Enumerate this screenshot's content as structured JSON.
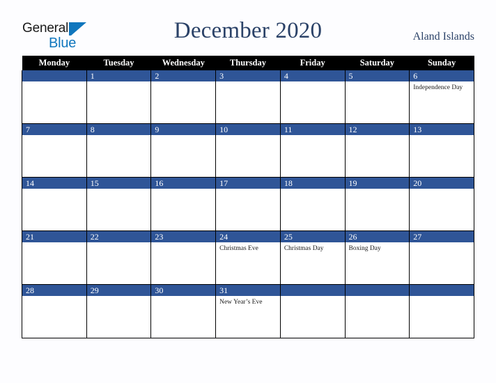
{
  "brand": {
    "name_part1": "General",
    "name_part2": "Blue",
    "logo_icon": "triangle-flag-icon"
  },
  "header": {
    "title": "December 2020",
    "country": "Aland Islands"
  },
  "calendar": {
    "month": "December",
    "year": "2020",
    "weekday_headers": [
      "Monday",
      "Tuesday",
      "Wednesday",
      "Thursday",
      "Friday",
      "Saturday",
      "Sunday"
    ],
    "colors": {
      "header_bg": "#000000",
      "date_bar_bg": "#2f5597",
      "title_text": "#2b4268",
      "brand_blue": "#0f76bd",
      "page_bg": "#fdfdff",
      "cell_bg": "#ffffff",
      "grid_line": "#000000"
    },
    "weeks": [
      [
        {
          "day": "",
          "event": ""
        },
        {
          "day": "1",
          "event": ""
        },
        {
          "day": "2",
          "event": ""
        },
        {
          "day": "3",
          "event": ""
        },
        {
          "day": "4",
          "event": ""
        },
        {
          "day": "5",
          "event": ""
        },
        {
          "day": "6",
          "event": "Independence Day"
        }
      ],
      [
        {
          "day": "7",
          "event": ""
        },
        {
          "day": "8",
          "event": ""
        },
        {
          "day": "9",
          "event": ""
        },
        {
          "day": "10",
          "event": ""
        },
        {
          "day": "11",
          "event": ""
        },
        {
          "day": "12",
          "event": ""
        },
        {
          "day": "13",
          "event": ""
        }
      ],
      [
        {
          "day": "14",
          "event": ""
        },
        {
          "day": "15",
          "event": ""
        },
        {
          "day": "16",
          "event": ""
        },
        {
          "day": "17",
          "event": ""
        },
        {
          "day": "18",
          "event": ""
        },
        {
          "day": "19",
          "event": ""
        },
        {
          "day": "20",
          "event": ""
        }
      ],
      [
        {
          "day": "21",
          "event": ""
        },
        {
          "day": "22",
          "event": ""
        },
        {
          "day": "23",
          "event": ""
        },
        {
          "day": "24",
          "event": "Christmas Eve"
        },
        {
          "day": "25",
          "event": "Christmas Day"
        },
        {
          "day": "26",
          "event": "Boxing Day"
        },
        {
          "day": "27",
          "event": ""
        }
      ],
      [
        {
          "day": "28",
          "event": ""
        },
        {
          "day": "29",
          "event": ""
        },
        {
          "day": "30",
          "event": ""
        },
        {
          "day": "31",
          "event": "New Year’s Eve"
        },
        {
          "day": "",
          "event": ""
        },
        {
          "day": "",
          "event": ""
        },
        {
          "day": "",
          "event": ""
        }
      ]
    ]
  }
}
